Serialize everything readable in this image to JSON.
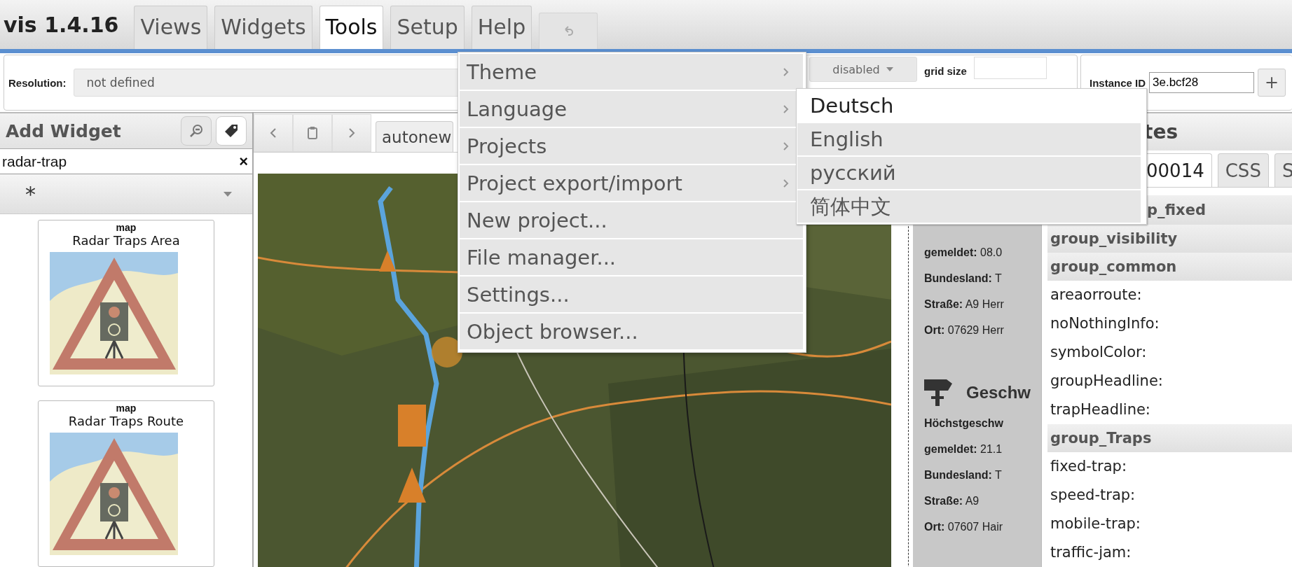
{
  "app": {
    "title": "vis 1.4.16"
  },
  "tabs": [
    {
      "label": "Views",
      "selected": false
    },
    {
      "label": "Widgets",
      "selected": false
    },
    {
      "label": "Tools",
      "selected": true
    },
    {
      "label": "Setup",
      "selected": false
    },
    {
      "label": "Help",
      "selected": false
    }
  ],
  "toolbar": {
    "resolution_label": "Resolution:",
    "resolution_value": "not defined",
    "snap_value": "disabled",
    "grid_size_label": "grid size",
    "instance_label": "Instance ID",
    "instance_value": "3e.bcf28",
    "add_button": "+"
  },
  "add_widget": {
    "title": "Add Widget",
    "search_value": "radar-trap",
    "clear": "×",
    "filter": "*",
    "widgets": [
      {
        "set": "map",
        "name": "Radar Traps Area"
      },
      {
        "set": "map",
        "name": "Radar Traps Route"
      }
    ]
  },
  "editor": {
    "view_tab": "autonew"
  },
  "info_widget": {
    "lines": [
      "**gemeldet:** 08.0",
      "**Bundesland:** T",
      "**Straße:** A9 Herr",
      "**Ort:** 07629 Herr"
    ],
    "section_title": "Geschw",
    "section_lines": [
      "**Höchstgeschw**",
      "**gemeldet:** 21.1",
      "**Bundesland:** T",
      "**Straße:** A9",
      "**Ort:** 07607 Hair"
    ]
  },
  "attributes": {
    "title": "tes",
    "tabs": [
      {
        "label": "00014",
        "selected": true
      },
      {
        "label": "CSS",
        "selected": false
      },
      {
        "label": "S",
        "selected": false
      }
    ],
    "rows": [
      {
        "kind": "group",
        "label": "p_fixed"
      },
      {
        "kind": "group",
        "label": "group_visibility"
      },
      {
        "kind": "group",
        "label": "group_common"
      },
      {
        "kind": "property",
        "label": "areaorroute:"
      },
      {
        "kind": "property",
        "label": "noNothingInfo:"
      },
      {
        "kind": "property",
        "label": "symbolColor:"
      },
      {
        "kind": "property",
        "label": "groupHeadline:"
      },
      {
        "kind": "property",
        "label": "trapHeadline:"
      },
      {
        "kind": "group",
        "label": "group_Traps"
      },
      {
        "kind": "property",
        "label": "fixed-trap:"
      },
      {
        "kind": "property",
        "label": "speed-trap:"
      },
      {
        "kind": "property",
        "label": "mobile-trap:"
      },
      {
        "kind": "property",
        "label": "traffic-jam:"
      }
    ]
  },
  "menu": {
    "items": [
      {
        "label": "Theme",
        "submenu": true
      },
      {
        "label": "Language",
        "submenu": true
      },
      {
        "label": "Projects",
        "submenu": true
      },
      {
        "label": "Project export/import",
        "submenu": true
      },
      {
        "label": "New project...",
        "submenu": false
      },
      {
        "label": "File manager...",
        "submenu": false
      },
      {
        "label": "Settings...",
        "submenu": false
      },
      {
        "label": "Object browser...",
        "submenu": false
      }
    ]
  },
  "submenu": {
    "items": [
      {
        "label": "Deutsch",
        "selected": true
      },
      {
        "label": "English",
        "selected": false
      },
      {
        "label": "русский",
        "selected": false
      },
      {
        "label": "简体中文",
        "selected": false
      }
    ]
  }
}
